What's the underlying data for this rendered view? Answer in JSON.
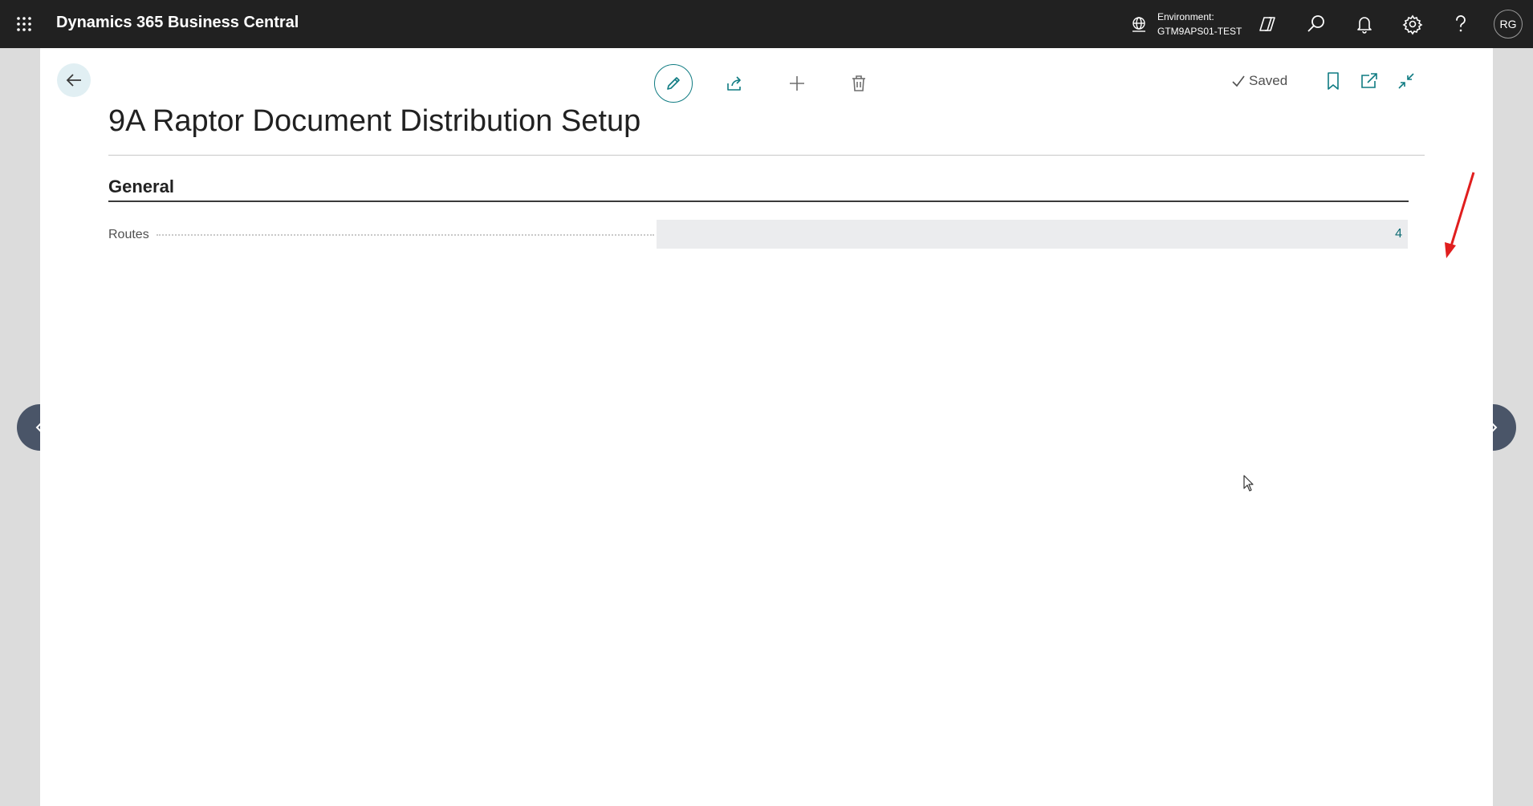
{
  "topbar": {
    "app_title": "Dynamics 365 Business Central",
    "environment_label": "Environment:",
    "environment_value": "GTM9APS01-TEST",
    "user_initials": "RG",
    "icons": [
      "app-launcher-icon",
      "environment-icon",
      "copilot-icon",
      "search-icon",
      "bell-icon",
      "gear-icon",
      "help-icon"
    ]
  },
  "toolbar": {
    "actions": [
      "edit-icon",
      "share-icon",
      "add-icon",
      "delete-icon"
    ],
    "saved_label": "Saved",
    "right_icons": [
      "bookmark-icon",
      "open-new-window-icon",
      "collapse-icon"
    ]
  },
  "page": {
    "title": "9A Raptor Document Distribution Setup",
    "section_title": "General",
    "fields": [
      {
        "label": "Routes",
        "value": "4"
      }
    ]
  },
  "colors": {
    "topbar_bg": "#212121",
    "accent": "#0f7b82",
    "field_bg": "#ebecee",
    "nav_button_bg": "#4a5568",
    "annotation_arrow": "#e01e1e"
  }
}
